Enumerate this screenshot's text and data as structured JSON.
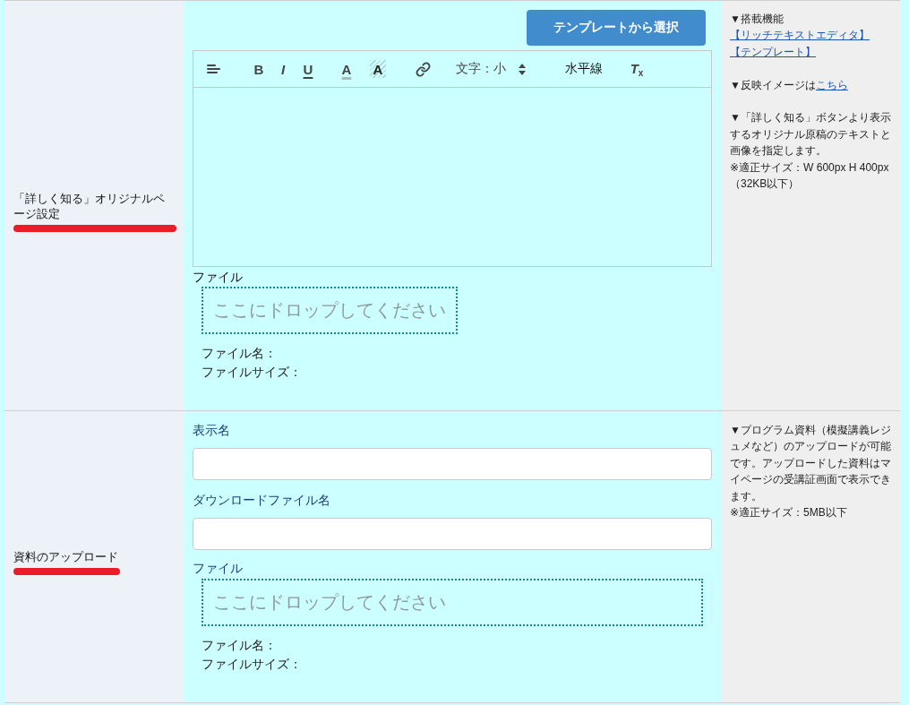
{
  "sections": [
    {
      "kind": "editor",
      "label": "「詳しく知る」オリジナルページ設定",
      "label_marked": true,
      "template_button": "テンプレートから選択",
      "toolbar": [
        {
          "kind": "align"
        },
        {
          "kind": "bold",
          "text": "B"
        },
        {
          "kind": "italic",
          "text": "I"
        },
        {
          "kind": "underline",
          "text": "U"
        },
        {
          "kind": "font_color",
          "text": "A"
        },
        {
          "kind": "background",
          "text": "A"
        },
        {
          "kind": "link"
        },
        {
          "kind": "size",
          "text": "文字：小"
        },
        {
          "kind": "hr",
          "text": "水平線"
        },
        {
          "kind": "clean",
          "text": "T$_{x}$"
        }
      ],
      "file": {
        "label": "ファイル",
        "dropzone": "ここにドロップしてください",
        "name_label": "ファイル名：",
        "size_label": "ファイルサイズ："
      },
      "notes": [
        {
          "kind": "features",
          "heading": "▼搭載機能",
          "links": [
            "【リッチテキストエディタ】",
            "【テンプレート】"
          ]
        },
        {
          "kind": "link_line",
          "text": "▼反映イメージは",
          "link": "こちら"
        },
        {
          "kind": "paragraph",
          "lines": [
            "▼「詳しく知る」ボタンより表示するオリジナル原稿のテキストと画像を指定します。",
            "※適正サイズ：W 600px H 400px（32KB以下）"
          ]
        }
      ]
    },
    {
      "kind": "upload",
      "label": "資料のアップロード",
      "label_marked": true,
      "fields": [
        {
          "label": "表示名"
        },
        {
          "label": "ダウンロードファイル名"
        }
      ],
      "file": {
        "label": "ファイル",
        "dropzone": "ここにドロップしてください",
        "name_label": "ファイル名：",
        "size_label": "ファイルサイズ："
      },
      "notes": [
        {
          "kind": "paragraph",
          "lines": [
            "▼プログラム資料（模擬講義レジュメなど）のアップロードが可能です。アップロードした資料はマイページの受講証画面で表示できます。",
            "※適正サイズ：5MB以下"
          ]
        }
      ]
    }
  ]
}
